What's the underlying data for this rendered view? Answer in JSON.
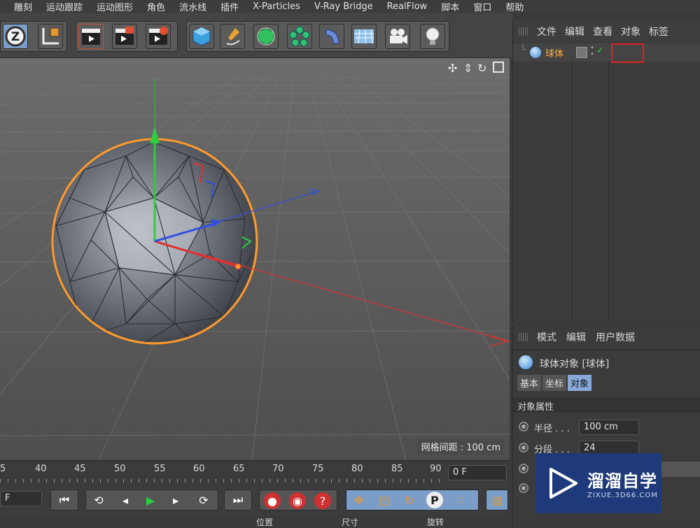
{
  "menu": [
    "雕刻",
    "运动跟踪",
    "运动图形",
    "角色",
    "流水线",
    "插件",
    "X-Particles",
    "V-Ray Bridge",
    "RealFlow",
    "脚本",
    "窗口",
    "帮助"
  ],
  "object_manager": {
    "menu": [
      "文件",
      "编辑",
      "查看",
      "对象",
      "标签"
    ],
    "object_name": "球体"
  },
  "attribute_manager": {
    "menu": [
      "模式",
      "编辑",
      "用户数据"
    ],
    "title": "球体对象 [球体]",
    "tabs": [
      "基本",
      "坐标",
      "对象"
    ],
    "active_tab": "对象",
    "section": "对象属性",
    "fields": [
      {
        "label": "半径 . . .",
        "value": "100 cm"
      },
      {
        "label": "分段 . . .",
        "value": "24"
      }
    ]
  },
  "viewport": {
    "grid_spacing": "网格间距 : 100 cm"
  },
  "timeline": {
    "ticks": [
      "5",
      "40",
      "45",
      "50",
      "55",
      "60",
      "65",
      "70",
      "75",
      "80",
      "85",
      "90"
    ],
    "current_frame": "0 F",
    "start_field": "F"
  },
  "coord_bar": [
    "位置",
    "尺寸",
    "旋转"
  ],
  "watermark": {
    "brand": "溜溜自学",
    "url": "ZIXUE.3D66.COM"
  },
  "colors": {
    "axis_x": "#e03030",
    "axis_y": "#2ecc40",
    "axis_z": "#3050e0",
    "selection": "#ff9a2a",
    "highlight_box": "#e02020",
    "active_tab": "#88a9d8"
  }
}
